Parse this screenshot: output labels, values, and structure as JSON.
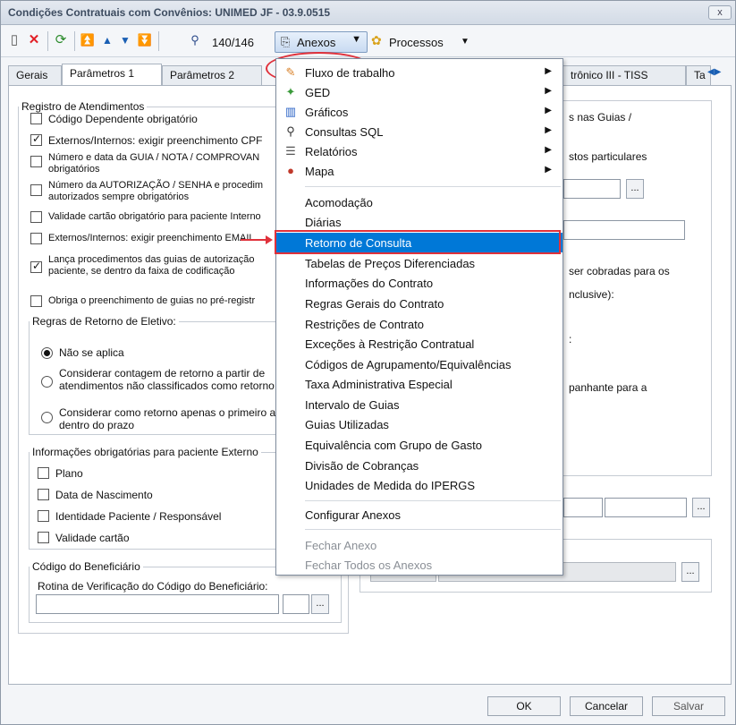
{
  "window": {
    "title": "Condições Contratuais com Convênios: UNIMED JF - 03.9.0515",
    "close_label": "x"
  },
  "toolbar": {
    "counter": "140/146",
    "anexos_label": "Anexos",
    "processos_label": "Processos",
    "icons": [
      "new-icon",
      "delete-icon",
      "refresh-icon",
      "first-icon",
      "prev-icon",
      "next-icon",
      "last-icon",
      "find-icon"
    ]
  },
  "tabs": [
    "Gerais",
    "Parâmetros 1",
    "Parâmetros 2",
    "trônico III - TISS",
    "Ta"
  ],
  "left": {
    "registro_title": "Registro de Atendimentos",
    "registro_items": [
      {
        "label": "Código Dependente obrigatório",
        "checked": false
      },
      {
        "label": "Externos/Internos: exigir preenchimento CPF",
        "checked": true
      },
      {
        "label": "Número e data da GUIA / NOTA / COMPROVAN",
        "label2": "obrigatórios",
        "checked": false
      },
      {
        "label": "Número da AUTORIZAÇÃO / SENHA e procedim",
        "label2": "autorizados sempre obrigatórios",
        "checked": false
      },
      {
        "label": "Validade cartão obrigatório para paciente Interno",
        "checked": false
      },
      {
        "label": "Externos/Internos: exigir preenchimento EMAIL",
        "checked": false
      },
      {
        "label": "Lança procedimentos das guias de autorização",
        "label2": "paciente, se dentro da faixa de codificação",
        "checked": true
      },
      {
        "label": "Obriga o preenchimento de guias no pré-registr",
        "checked": false
      }
    ],
    "retorno_title": "Regras de Retorno de Eletivo:",
    "retorno_items": [
      {
        "label": "Não se aplica",
        "checked": true
      },
      {
        "label": "Considerar contagem de retorno a partir de",
        "label2": "atendimentos não classificados como retorno",
        "checked": false
      },
      {
        "label": "Considerar como retorno apenas o primeiro a",
        "label2": "dentro do prazo",
        "checked": false
      }
    ],
    "externo_title": "Informações obrigatórias para paciente Externo",
    "externo_items": [
      "Plano",
      "Data de Nascimento",
      "Identidade Paciente / Responsável",
      "Validade cartão"
    ],
    "beneficiario_title": "Código do Beneficiário",
    "beneficiario_label": "Rotina de Verificação do Código do Beneficiário:"
  },
  "right": {
    "t1": "s nas Guias /",
    "t2": "stos particulares",
    "t3": "ser cobradas para os",
    "t4": "nclusive):",
    "t5": ":",
    "t6": "panhante para a"
  },
  "menu": {
    "items": [
      {
        "label": "Fluxo de trabalho",
        "icon": "workflow-icon",
        "sub": true
      },
      {
        "label": "GED",
        "icon": "ged-icon",
        "sub": true
      },
      {
        "label": "Gráficos",
        "icon": "chart-icon",
        "sub": true
      },
      {
        "label": "Consultas SQL",
        "icon": "sql-icon",
        "sub": true
      },
      {
        "label": "Relatórios",
        "icon": "report-icon",
        "sub": true
      },
      {
        "label": "Mapa",
        "icon": "map-pin-icon",
        "sub": true
      },
      {
        "label": "Acomodação"
      },
      {
        "label": "Diárias"
      },
      {
        "label": "Retorno de Consulta",
        "selected": true
      },
      {
        "label": "Tabelas de Preços Diferenciadas"
      },
      {
        "label": "Informações do Contrato"
      },
      {
        "label": "Regras Gerais do Contrato"
      },
      {
        "label": "Restrições de Contrato"
      },
      {
        "label": "Exceções à Restrição Contratual"
      },
      {
        "label": "Códigos de Agrupamento/Equivalências"
      },
      {
        "label": "Taxa Administrativa Especial"
      },
      {
        "label": "Intervalo de Guias"
      },
      {
        "label": "Guias Utilizadas"
      },
      {
        "label": "Equivalência com Grupo de Gasto"
      },
      {
        "label": "Divisão de Cobranças"
      },
      {
        "label": "Unidades de Medida do IPERGS"
      },
      {
        "label": "Configurar Anexos"
      },
      {
        "label": "Fechar Anexo",
        "disabled": true
      },
      {
        "label": "Fechar Todos os Anexos",
        "disabled": true
      }
    ]
  },
  "footer": {
    "ok": "OK",
    "cancel": "Cancelar",
    "save": "Salvar"
  },
  "ellipsis": "..."
}
